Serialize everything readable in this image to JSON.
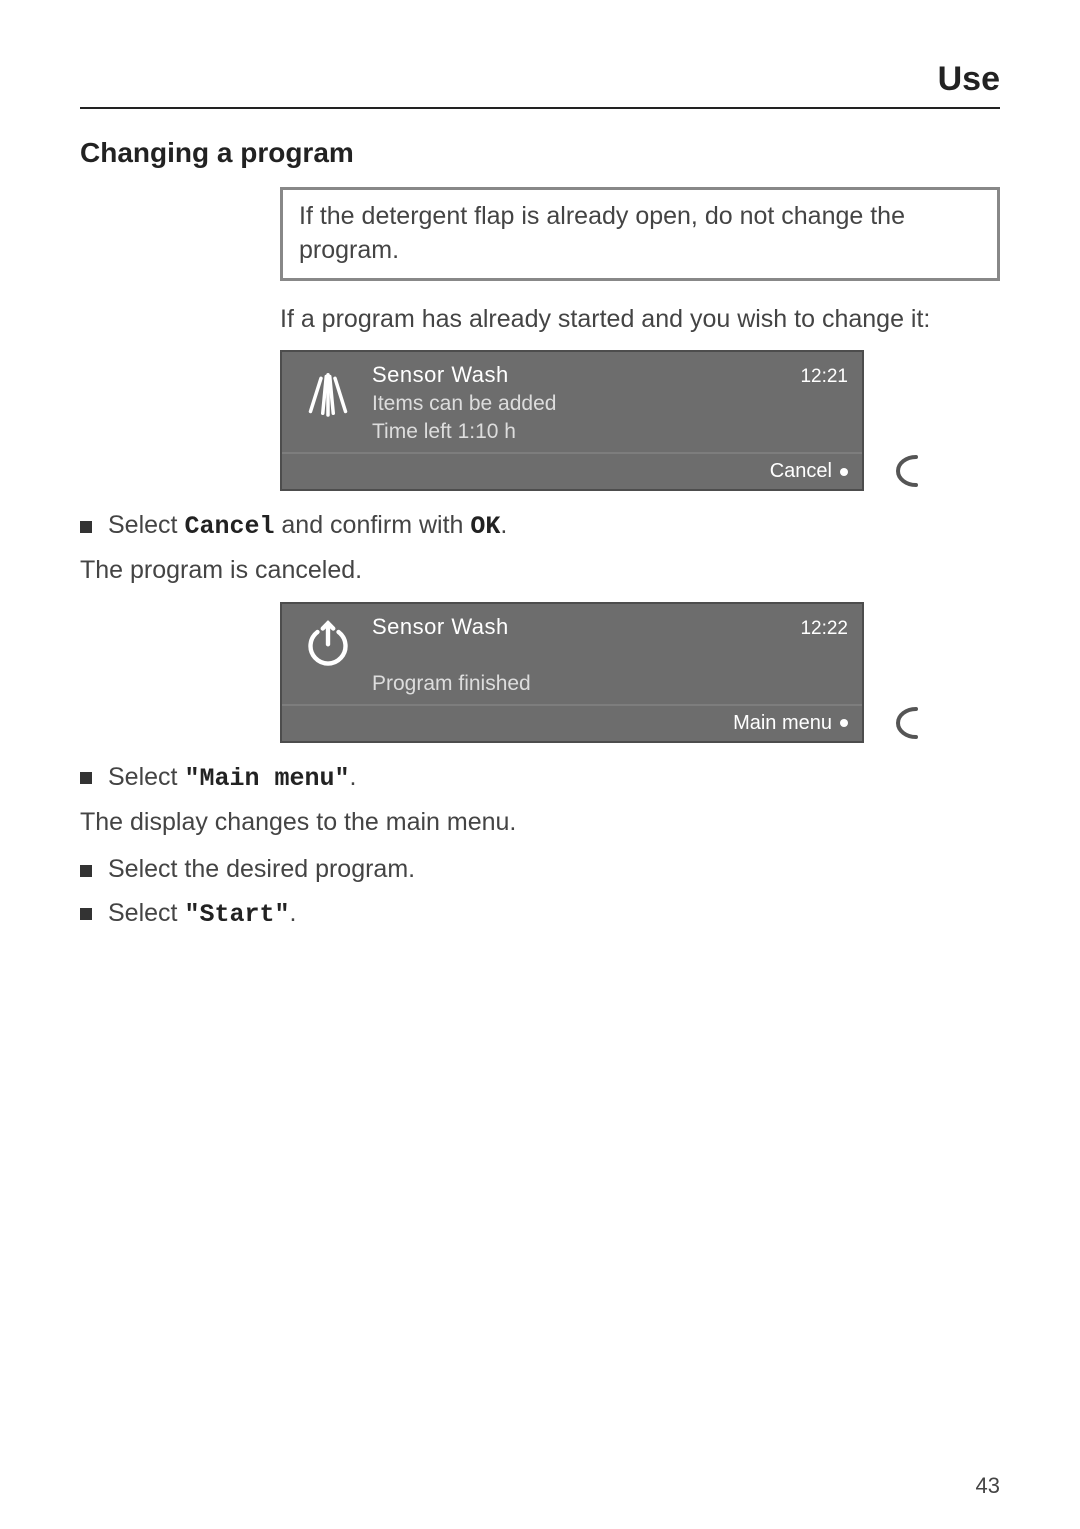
{
  "header": {
    "title": "Use"
  },
  "section": {
    "heading": "Changing a program"
  },
  "callout": "If the detergent flap is already open, do not change the program.",
  "intro": "If a program has already started and you wish to change it:",
  "screen1": {
    "icon": "spray-icon",
    "title": "Sensor Wash",
    "clock": "12:21",
    "line1": "Items can be added",
    "line2": "Time left 1:10 h",
    "action": "Cancel"
  },
  "step1": {
    "prefix": "Select ",
    "bold1": "Cancel",
    "mid": " and confirm with ",
    "bold2": "OK",
    "suffix": "."
  },
  "cancelled_text": "The program is canceled.",
  "screen2": {
    "icon": "power-icon",
    "title": "Sensor Wash",
    "clock": "12:22",
    "line2": "Program finished",
    "action": "Main menu"
  },
  "step2": {
    "prefix": "Select ",
    "bold1": "\"Main menu\"",
    "suffix": "."
  },
  "display_text": "The display changes to the main menu.",
  "step3": "Select the desired program.",
  "step4": {
    "prefix": "Select ",
    "bold1": "\"Start\"",
    "suffix": "."
  },
  "page_number": "43"
}
